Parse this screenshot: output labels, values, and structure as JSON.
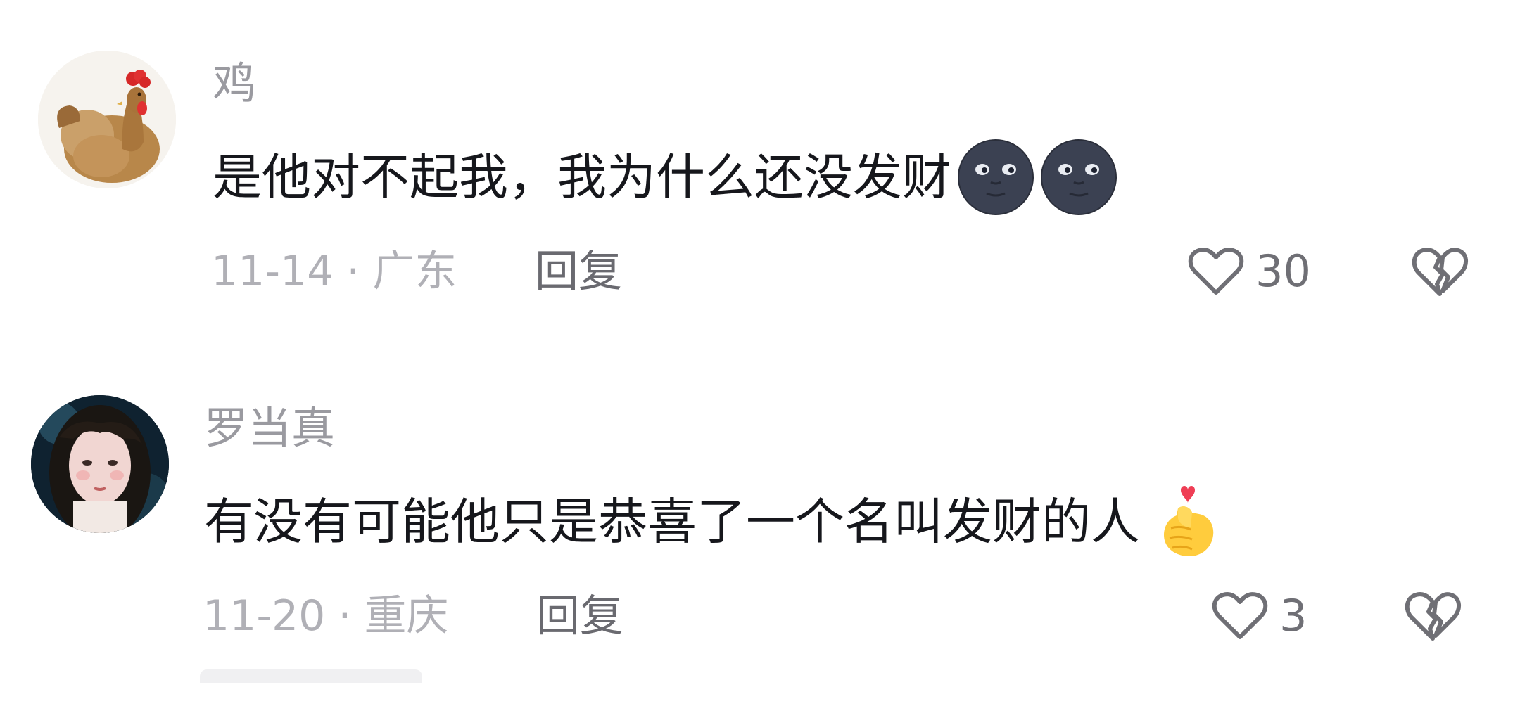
{
  "comments": [
    {
      "username": "鸡",
      "text": "是他对不起我，我为什么还没发财",
      "emojis": [
        "new-moon-face-emoji",
        "new-moon-face-emoji"
      ],
      "date": "11-14",
      "separator": "·",
      "location": "广东",
      "reply_label": "回复",
      "like_count": "30"
    },
    {
      "username": "罗当真",
      "text": "有没有可能他只是恭喜了一个名叫发财的人",
      "emojis": [
        "finger-heart-emoji"
      ],
      "date": "11-20",
      "separator": "·",
      "location": "重庆",
      "reply_label": "回复",
      "like_count": "3"
    }
  ],
  "colors": {
    "username": "#9a9aa0",
    "body_text": "#16171c",
    "meta": "#b0b0b6",
    "reply": "#6a6a70",
    "icon_stroke": "#6f6f75"
  }
}
